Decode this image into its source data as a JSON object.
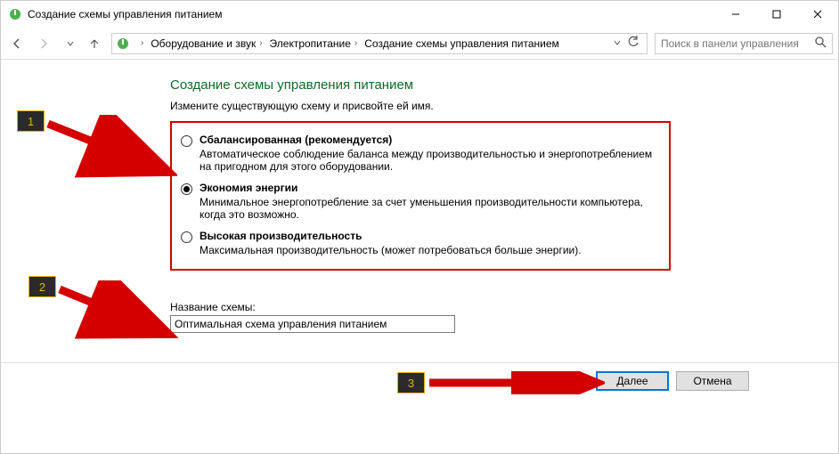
{
  "titlebar": {
    "title": "Создание схемы управления питанием"
  },
  "breadcrumbs": {
    "items": [
      "Оборудование и звук",
      "Электропитание",
      "Создание схемы управления питанием"
    ]
  },
  "search": {
    "placeholder": "Поиск в панели управления"
  },
  "page": {
    "heading": "Создание схемы управления питанием",
    "subhead": "Измените существующую схему и присвойте ей имя."
  },
  "plans": {
    "balanced": {
      "title": "Сбалансированная (рекомендуется)",
      "desc": "Автоматическое соблюдение баланса между производительностью и энергопотреблением на пригодном для этого оборудовании."
    },
    "saver": {
      "title": "Экономия энергии",
      "desc": "Минимальное энергопотребление за счет уменьшения производительности компьютера, когда это возможно."
    },
    "high": {
      "title": "Высокая производительность",
      "desc": "Максимальная производительность (может потребоваться больше энергии)."
    }
  },
  "name_section": {
    "label": "Название схемы:",
    "value": "Оптимальная схема управления питанием"
  },
  "buttons": {
    "next": "Далее",
    "cancel": "Отмена"
  },
  "badges": {
    "b1": "1",
    "b2": "2",
    "b3": "3"
  }
}
